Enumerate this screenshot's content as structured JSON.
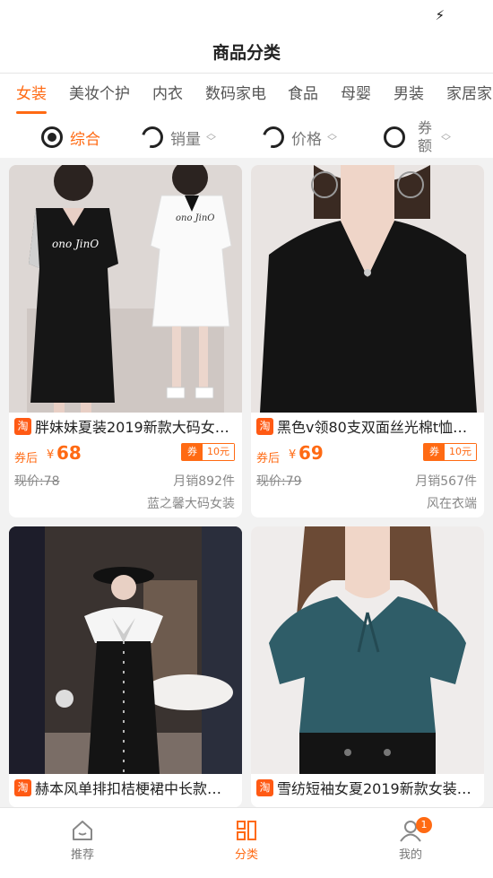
{
  "status_bar": {
    "icon": "bolt-icon"
  },
  "header": {
    "title": "商品分类"
  },
  "categories": [
    "女装",
    "美妆个护",
    "内衣",
    "数码家电",
    "食品",
    "母婴",
    "男装",
    "家居家"
  ],
  "active_category": "女装",
  "sort": {
    "items": [
      {
        "label": "综合",
        "active": true,
        "checked": true
      },
      {
        "label": "销量",
        "active": false
      },
      {
        "label": "价格",
        "active": false
      },
      {
        "label": "券额",
        "active": false
      }
    ],
    "coupon_label_line1": "券",
    "coupon_label_line2": "额"
  },
  "products": [
    {
      "title": "胖妹妹夏装2019新款大码女…",
      "platform": "淘",
      "after_label": "券后",
      "currency": "¥",
      "price": "68",
      "coupon_tag": "券",
      "coupon_amount": "10元",
      "original_price": "现价:78",
      "monthly_sales": "月销892件",
      "shop": "蓝之馨大码女装"
    },
    {
      "title": "黑色v领80支双面丝光棉t恤…",
      "platform": "淘",
      "after_label": "券后",
      "currency": "¥",
      "price": "69",
      "coupon_tag": "券",
      "coupon_amount": "10元",
      "original_price": "现价:79",
      "monthly_sales": "月销567件",
      "shop": "风在衣端"
    },
    {
      "title": "赫本风单排扣桔梗裙中长款…",
      "platform": "淘"
    },
    {
      "title": "雪纺短袖女夏2019新款女装…",
      "platform": "淘"
    }
  ],
  "bottom_nav": [
    {
      "label": "推荐",
      "icon": "home-icon",
      "active": false
    },
    {
      "label": "分类",
      "icon": "category-icon",
      "active": true
    },
    {
      "label": "我的",
      "icon": "user-icon",
      "active": false,
      "badge": "1"
    }
  ],
  "colors": {
    "accent": "#ff6a13",
    "background": "#f2f2f2"
  }
}
